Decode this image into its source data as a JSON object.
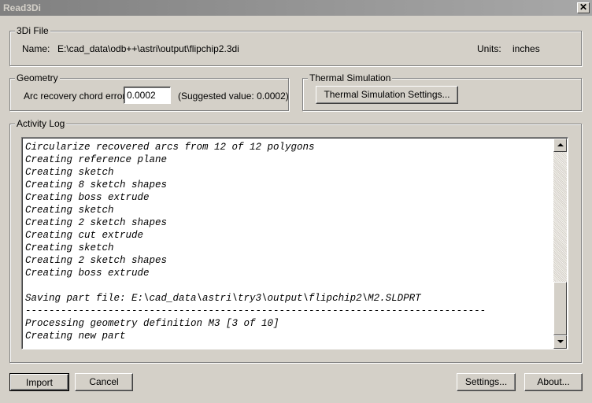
{
  "window": {
    "title": "Read3Di",
    "close_glyph": "✕"
  },
  "file_group": {
    "legend": "3Di File",
    "name_label": "Name:",
    "name_value": "E:\\cad_data\\odb++\\astri\\output\\flipchip2.3di",
    "units_label": "Units:",
    "units_value": "inches"
  },
  "geometry_group": {
    "legend": "Geometry",
    "chord_label": "Arc recovery chord error:",
    "chord_value": "0.0002",
    "suggested": "(Suggested value: 0.0002)"
  },
  "thermal_group": {
    "legend": "Thermal Simulation",
    "settings_button": "Thermal Simulation Settings..."
  },
  "activity_log": {
    "legend": "Activity Log",
    "lines": [
      "Circularize recovered arcs from 12 of 12 polygons",
      "Creating reference plane",
      "Creating sketch",
      "Creating 8 sketch shapes",
      "Creating boss extrude",
      "Creating sketch",
      "Creating 2 sketch shapes",
      "Creating cut extrude",
      "Creating sketch",
      "Creating 2 sketch shapes",
      "Creating boss extrude",
      "",
      "Saving part file: E:\\cad_data\\astri\\try3\\output\\flipchip2\\M2.SLDPRT",
      "------------------------------------------------------------------------------",
      "Processing geometry definition M3 [3 of 10]",
      "Creating new part"
    ]
  },
  "buttons": {
    "import": "Import",
    "cancel": "Cancel",
    "settings": "Settings...",
    "about": "About..."
  }
}
